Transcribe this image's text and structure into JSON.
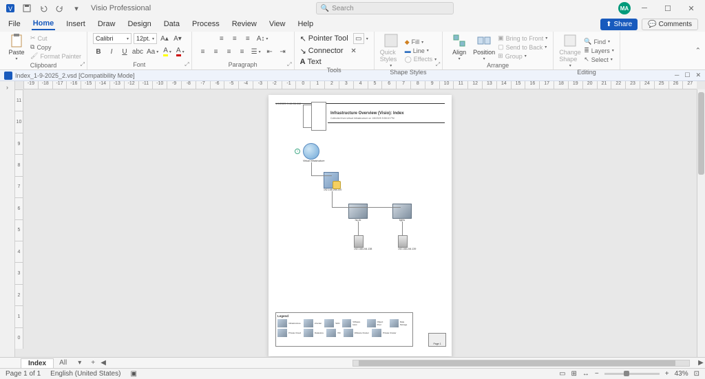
{
  "titlebar": {
    "app_title": "Visio Professional",
    "search_placeholder": "Search",
    "avatar_initials": "MA"
  },
  "menu": {
    "items": [
      "File",
      "Home",
      "Insert",
      "Draw",
      "Design",
      "Data",
      "Process",
      "Review",
      "View",
      "Help"
    ],
    "active": "Home",
    "share": "Share",
    "comments": "Comments"
  },
  "ribbon": {
    "clipboard": {
      "paste": "Paste",
      "cut": "Cut",
      "copy": "Copy",
      "format_painter": "Format Painter",
      "label": "Clipboard"
    },
    "font": {
      "name": "Calibri",
      "size": "12pt.",
      "label": "Font"
    },
    "paragraph": {
      "label": "Paragraph"
    },
    "tools": {
      "pointer": "Pointer Tool",
      "connector": "Connector",
      "text": "Text",
      "label": "Tools"
    },
    "shapestyles": {
      "fill": "Fill",
      "line": "Line",
      "effects": "Effects",
      "quick": "Quick Styles",
      "label": "Shape Styles"
    },
    "arrange": {
      "align": "Align",
      "position": "Position",
      "bringfront": "Bring to Front",
      "sendback": "Send to Back",
      "group": "Group",
      "label": "Arrange"
    },
    "editing": {
      "change": "Change Shape",
      "find": "Find",
      "layers": "Layers",
      "select": "Select",
      "label": "Editing"
    }
  },
  "doc": {
    "filename": "Index_1-9-2025_2.vsd  [Compatibility Mode]"
  },
  "ruler_h": [
    "-19",
    "-18",
    "-17",
    "-16",
    "-15",
    "-14",
    "-13",
    "-12",
    "-11",
    "-10",
    "-9",
    "-8",
    "-7",
    "-6",
    "-5",
    "-4",
    "-3",
    "-2",
    "-1",
    "0",
    "1",
    "2",
    "3",
    "4",
    "5",
    "6",
    "7",
    "8",
    "9",
    "10",
    "11",
    "12",
    "13",
    "14",
    "15",
    "16",
    "17",
    "18",
    "19",
    "20",
    "21",
    "22",
    "23",
    "24",
    "25",
    "26",
    "27"
  ],
  "ruler_v": [
    "11",
    "10",
    "9",
    "8",
    "7",
    "6",
    "5",
    "4",
    "3",
    "2",
    "1",
    "0"
  ],
  "page": {
    "date": "1/9/2025 9:46:06 AM",
    "title": "Infrastructure Overview (Visio): Index",
    "subtitle": "Collected from virtual infrastructure on 1/8/2025 5:58:10 PM",
    "nodes": {
      "globe": "Virtual Infrastructure",
      "building": "192.168.244.220",
      "rack1": "hq-dc",
      "rack2": "lights",
      "server1": "192.168.244.138",
      "server2": "192.168.244.139"
    },
    "legend_title": "Legend",
    "legend_items": [
      "Infrastructure",
      "vCenter",
      "SAN",
      "VMware Host",
      "Object Pool",
      "Data Storage",
      "Private Cloud",
      "Datastore",
      "VM",
      "VMware Cluster",
      "Private Cluster"
    ],
    "page_tab": "Page 1"
  },
  "sheets": {
    "active": "Index",
    "all": "All",
    "add": "+"
  },
  "status": {
    "page": "Page 1 of 1",
    "lang": "English (United States)",
    "zoom": "43%"
  }
}
